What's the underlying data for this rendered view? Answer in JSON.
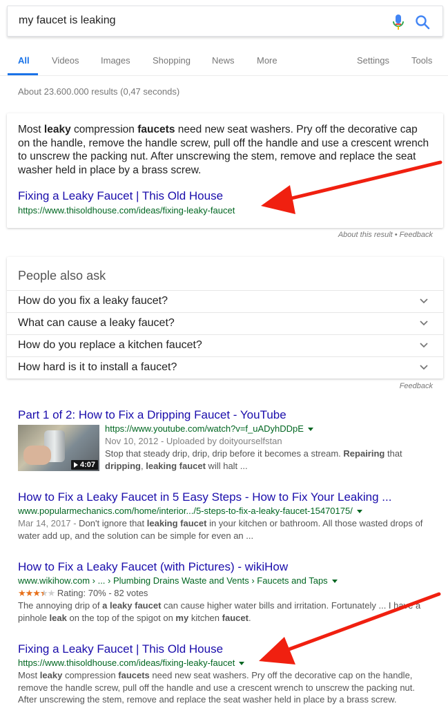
{
  "search": {
    "query": "my faucet is leaking"
  },
  "tabs": [
    "All",
    "Videos",
    "Images",
    "Shopping",
    "News",
    "More",
    "Settings",
    "Tools"
  ],
  "result_stats": "About 23.600.000 results (0,47 seconds)",
  "featured": {
    "text_parts": [
      "Most ",
      "leaky",
      " compression ",
      "faucets",
      " need new seat washers. Pry off the decorative cap on the handle, remove the handle screw, pull off the handle and use a crescent wrench to unscrew the packing nut. After unscrewing the stem, remove and replace the seat washer held in place by a brass screw."
    ],
    "link": "Fixing a Leaky Faucet | This Old House",
    "url": "https://www.thisoldhouse.com/ideas/fixing-leaky-faucet",
    "about": "About this result • Feedback"
  },
  "paa": {
    "title": "People also ask",
    "questions": [
      "How do you fix a leaky faucet?",
      "What can cause a leaky faucet?",
      "How do you replace a kitchen faucet?",
      "How hard is it to install a faucet?"
    ],
    "feedback": "Feedback"
  },
  "results": [
    {
      "title": "Part 1 of 2: How to Fix a Dripping Faucet - YouTube",
      "url": "https://www.youtube.com/watch?v=f_uADyhDDpE",
      "date": "Nov 10, 2012 - Uploaded by doityourselfstan",
      "duration": "4:07",
      "desc_parts": [
        "Stop that steady drip, drip, drip before it becomes a stream. ",
        "Repairing",
        " that ",
        "dripping",
        ", ",
        "leaking faucet",
        " will halt ..."
      ]
    },
    {
      "title": "How to Fix a Leaky Faucet in 5 Easy Steps - How to Fix Your Leaking ...",
      "url": "www.popularmechanics.com/home/interior.../5-steps-to-fix-a-leaky-faucet-15470175/",
      "date": "Mar 14, 2017 - ",
      "desc_parts": [
        "Don't ignore that ",
        "leaking faucet",
        " in your kitchen or bathroom. All those wasted drops of water add up, and the solution can be simple for even an ..."
      ]
    },
    {
      "title": "How to Fix a Leaky Faucet (with Pictures) - wikiHow",
      "url": "www.wikihow.com › ... › Plumbing Drains Waste and Vents › Faucets and Taps",
      "rating_text": "Rating: 70% - 82 votes",
      "rating": 3.5,
      "desc_parts": [
        "The annoying drip of ",
        "a leaky faucet",
        " can cause higher water bills and irritation. Fortunately ... I have a pinhole ",
        "leak",
        " on the top of the spigot on ",
        "my",
        " kitchen ",
        "faucet",
        "."
      ]
    },
    {
      "title": "Fixing a Leaky Faucet | This Old House",
      "url": "https://www.thisoldhouse.com/ideas/fixing-leaky-faucet",
      "desc_parts": [
        "Most ",
        "leaky",
        " compression ",
        "faucets",
        " need new seat washers. Pry off the decorative cap on the handle, remove the handle screw, pull off the handle and use a crescent wrench to unscrew the packing nut. After unscrewing the stem, remove and replace the seat washer held in place by a brass screw."
      ]
    }
  ],
  "colors": {
    "link": "#1a0dab",
    "url": "#006621",
    "accent": "#1a73e8",
    "arrow": "#f02010"
  }
}
